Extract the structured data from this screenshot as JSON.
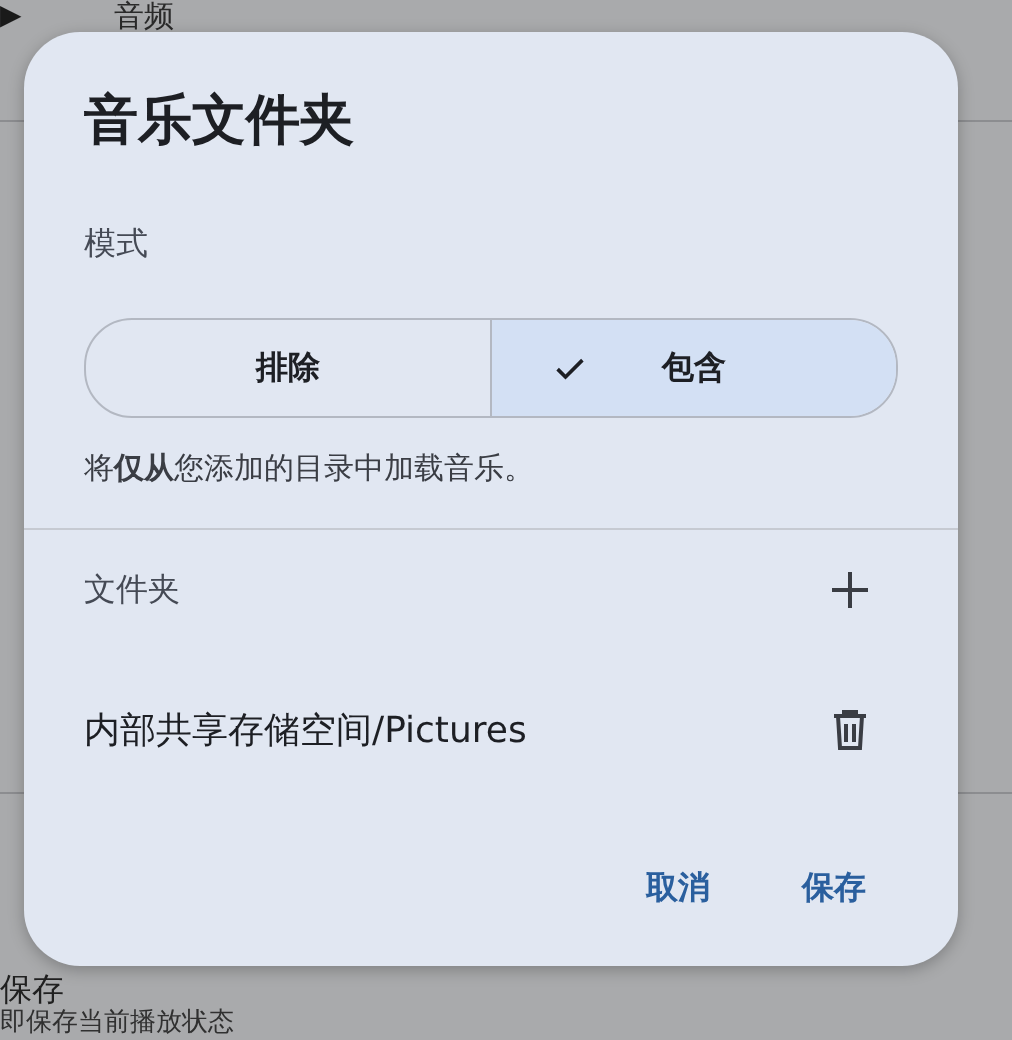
{
  "background": {
    "expand_icon": "▶",
    "section_title": "音频",
    "item_title": "保存",
    "item_subtitle": "即保存当前播放状态"
  },
  "dialog": {
    "title": "音乐文件夹",
    "mode_label": "模式",
    "modes": [
      {
        "label": "排除",
        "selected": false
      },
      {
        "label": "包含",
        "selected": true
      }
    ],
    "helper": "将**仅从**您添加的目录中加载音乐。",
    "folders_label": "文件夹",
    "folders": [
      {
        "path": "内部共享存储空间/Pictures"
      }
    ],
    "buttons": [
      {
        "label": "取消"
      },
      {
        "label": "保存"
      }
    ]
  }
}
